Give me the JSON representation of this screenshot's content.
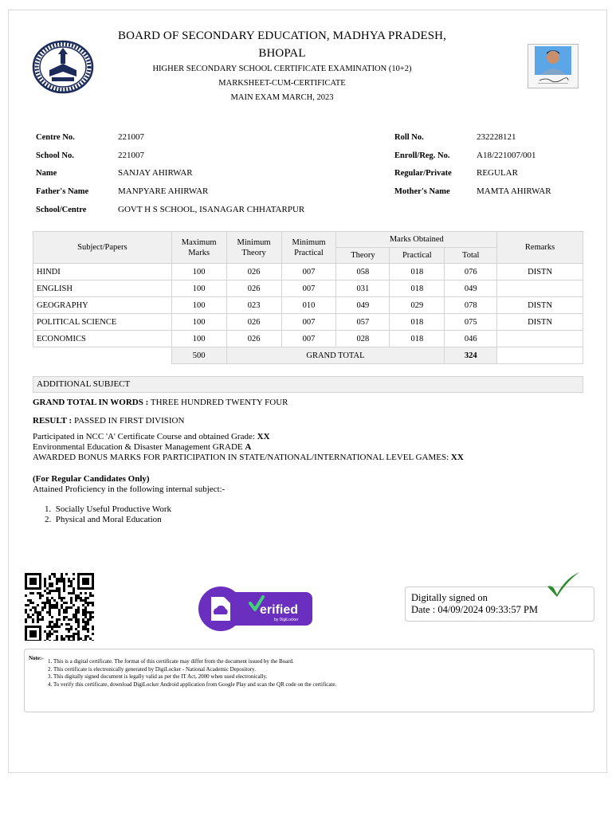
{
  "header": {
    "board_line1": "BOARD OF SECONDARY EDUCATION, MADHYA PRADESH,",
    "board_line2": "BHOPAL",
    "exam": "HIGHER SECONDARY SCHOOL CERTIFICATE EXAMINATION (10+2)",
    "doc_type": "MARKSHEET-CUM-CERTIFICATE",
    "session": "MAIN EXAM MARCH, 2023"
  },
  "logo_icon": "board-seal-icon",
  "photo_icon": "candidate-photo",
  "student": {
    "centre_label": "Centre No.",
    "centre_value": "221007",
    "school_label": "School No.",
    "school_value": "221007",
    "name_label": "Name",
    "name_value": "SANJAY AHIRWAR",
    "father_label": "Father's Name",
    "father_value": "MANPYARE AHIRWAR",
    "schoolcentre_label": "School/Centre",
    "schoolcentre_value": "GOVT H S SCHOOL, ISANAGAR CHHATARPUR",
    "roll_label": "Roll No.",
    "roll_value": "232228121",
    "enroll_label": "Enroll/Reg. No.",
    "enroll_value": "A18/221007/001",
    "regular_label": "Regular/Private",
    "regular_value": "REGULAR",
    "mother_label": "Mother's Name",
    "mother_value": "MAMTA AHIRWAR"
  },
  "table": {
    "h_subject": "Subject/Papers",
    "h_max1": "Maximum",
    "h_max2": "Marks",
    "h_mintheory1": "Minimum",
    "h_mintheory2": "Theory",
    "h_minprac1": "Minimum",
    "h_minprac2": "Practical",
    "h_obtained": "Marks Obtained",
    "h_theory": "Theory",
    "h_practical": "Practical",
    "h_total": "Total",
    "h_remarks": "Remarks",
    "rows": [
      {
        "subject": "HINDI",
        "max": "100",
        "min_theory": "026",
        "min_practical": "007",
        "theory": "058",
        "practical": "018",
        "total": "076",
        "remarks": "DISTN"
      },
      {
        "subject": "ENGLISH",
        "max": "100",
        "min_theory": "026",
        "min_practical": "007",
        "theory": "031",
        "practical": "018",
        "total": "049",
        "remarks": ""
      },
      {
        "subject": "GEOGRAPHY",
        "max": "100",
        "min_theory": "023",
        "min_practical": "010",
        "theory": "049",
        "practical": "029",
        "total": "078",
        "remarks": "DISTN"
      },
      {
        "subject": "POLITICAL SCIENCE",
        "max": "100",
        "min_theory": "026",
        "min_practical": "007",
        "theory": "057",
        "practical": "018",
        "total": "075",
        "remarks": "DISTN"
      },
      {
        "subject": "ECONOMICS",
        "max": "100",
        "min_theory": "026",
        "min_practical": "007",
        "theory": "028",
        "practical": "018",
        "total": "046",
        "remarks": ""
      }
    ],
    "footer_max": "500",
    "footer_label": "GRAND TOTAL",
    "footer_total": "324"
  },
  "additional_subject": "ADDITIONAL SUBJECT",
  "grand_total_words_label": "GRAND TOTAL IN WORDS :",
  "grand_total_words_value": "THREE HUNDRED TWENTY FOUR",
  "result_label": "RESULT :",
  "result_value": "PASSED IN FIRST DIVISION",
  "ncc_text": "Participated in NCC 'A' Certificate Course and obtained Grade:",
  "ncc_grade": "XX",
  "env_text": "Environmental Education & Disaster Management GRADE",
  "env_grade": "A",
  "bonus_text": "AWARDED BONUS MARKS FOR PARTICIPATION IN STATE/NATIONAL/INTERNATIONAL LEVEL GAMES:",
  "bonus_value": "XX",
  "regular_heading": "(For Regular Candidates Only)",
  "proficiency_text": "Attained Proficiency in the following internal subject:-",
  "internal_subjects": [
    "Socially Useful Productive Work",
    "Physical and Moral Education"
  ],
  "signature": {
    "line1": "Digitally signed on",
    "line2": "Date : 04/09/2024 09:33:57 PM"
  },
  "verified_badge": {
    "text": "erified",
    "sub": "by DigiLocker"
  },
  "qr_icon": "qr-code-icon",
  "note": {
    "title": "Note:-",
    "items": [
      "This is a digital certificate. The format of this certificate may differ from the document issued by the Board.",
      "This certificate is electronically generated by DigiLocker - National Academic Depository.",
      "This digitally signed document is legally valid as per the IT Act, 2000 when used electronically.",
      "To verify this certificate, download DigiLocker Android application from Google Play and scan the QR code on the certificate."
    ]
  }
}
